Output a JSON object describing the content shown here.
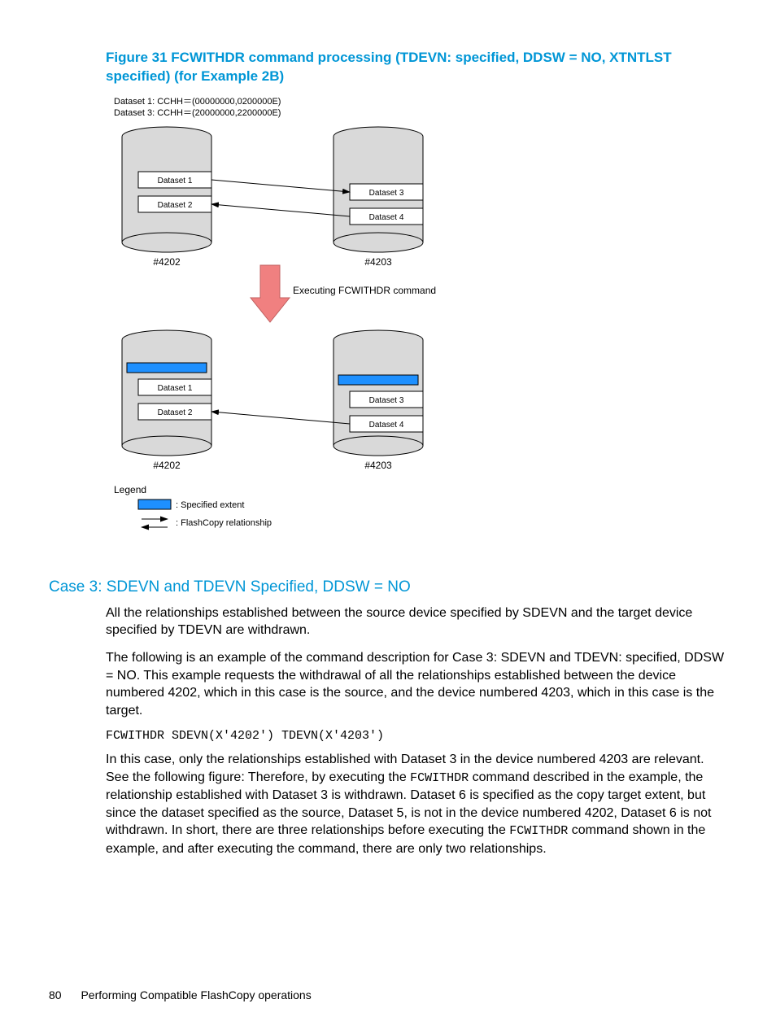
{
  "figure": {
    "title": "Figure 31 FCWITHDR command processing (TDEVN: specified, DDSW = NO, XTNTLST specified) (for Example 2B)",
    "datasets_header": {
      "line1": "Dataset 1:  CCHH＝(00000000,0200000E)",
      "line2": "Dataset 3:  CCHH＝(20000000,2200000E)"
    },
    "labels": {
      "ds1": "Dataset 1",
      "ds2": "Dataset 2",
      "ds3": "Dataset 3",
      "ds4": "Dataset 4",
      "dev_a": "#4202",
      "dev_b": "#4203",
      "exec": "Executing FCWITHDR command",
      "legend_title": "Legend",
      "legend_extent": ": Specified extent",
      "legend_fc": ": FlashCopy relationship"
    }
  },
  "case3": {
    "title": "Case 3: SDEVN and TDEVN Specified, DDSW = NO",
    "p1": "All the relationships established between the source device specified by SDEVN and the target device specified by TDEVN are withdrawn.",
    "p2": "The following is an example of the command description for Case 3: SDEVN and TDEVN: specified, DDSW = NO. This example requests the withdrawal of all the relationships established between the device numbered 4202, which in this case is the source, and the device numbered 4203, which in this case is the target.",
    "code": "FCWITHDR SDEVN(X'4202') TDEVN(X'4203')",
    "p3a": "In this case, only the relationships established with Dataset 3 in the device numbered 4203 are relevant. See the following figure: Therefore, by executing the ",
    "p3b": " command described in the example, the relationship established with Dataset 3 is withdrawn. Dataset 6 is specified as the copy target extent, but since the dataset specified as the source, Dataset 5, is not in the device numbered 4202, Dataset 6 is not withdrawn. In short, there are three relationships before executing the ",
    "p3c": " command shown in the example, and after executing the command, there are only two relationships.",
    "mono1": "FCWITHDR",
    "mono2": "FCWITHDR"
  },
  "footer": {
    "page": "80",
    "chapter": "Performing Compatible FlashCopy operations"
  }
}
